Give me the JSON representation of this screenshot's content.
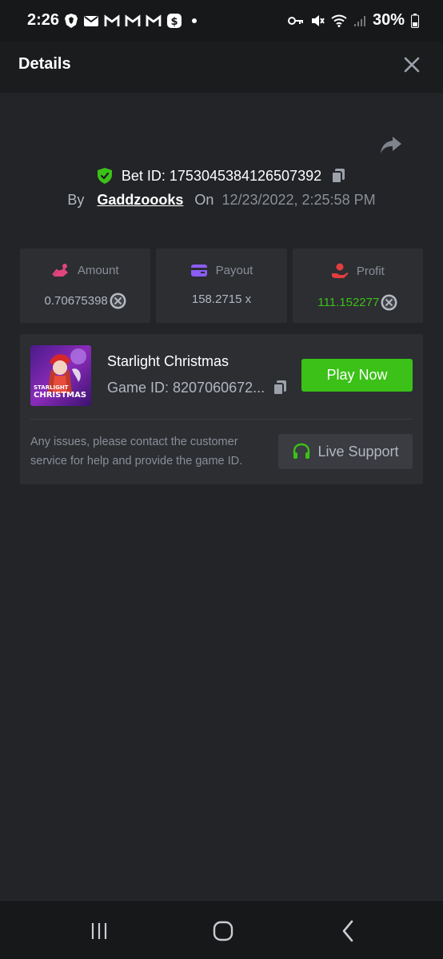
{
  "status_bar": {
    "time": "2:26",
    "battery": "30%",
    "icons_left": [
      "brave-icon",
      "mail-icon",
      "gmail-icon",
      "gmail-icon",
      "gmail-icon",
      "cash-app-icon",
      "dot-icon"
    ],
    "icons_right": [
      "key-icon",
      "mute-icon",
      "wifi-icon",
      "signal-icon",
      "battery-icon"
    ]
  },
  "header": {
    "title": "Details",
    "close_icon": "close-icon"
  },
  "bet": {
    "bet_id_label": "Bet ID: 1753045384126507392",
    "by_label": "By",
    "username": "Gaddzoooks",
    "on_label": "On",
    "date": "12/23/2022, 2:25:58 PM"
  },
  "stats": {
    "amount": {
      "label": "Amount",
      "value": "0.70675398",
      "icon": "amount-icon",
      "color": "#e0457b"
    },
    "payout": {
      "label": "Payout",
      "value": "158.2715 x",
      "icon": "wallet-icon",
      "color": "#8b5cf6"
    },
    "profit": {
      "label": "Profit",
      "value": "111.152277",
      "icon": "profit-icon",
      "color": "#e23d3d"
    }
  },
  "game": {
    "name": "Starlight Christmas",
    "game_id": "Game ID: 8207060672...",
    "thumb_text_1": "STARLIGHT",
    "thumb_text_2": "CHRISTMAS",
    "play_label": "Play Now",
    "support_text": "Any issues, please contact the customer service for help and provide the game ID.",
    "live_support_label": "Live Support"
  },
  "colors": {
    "accent_green": "#3bc117",
    "background": "#232427",
    "card": "#2c2e32"
  }
}
